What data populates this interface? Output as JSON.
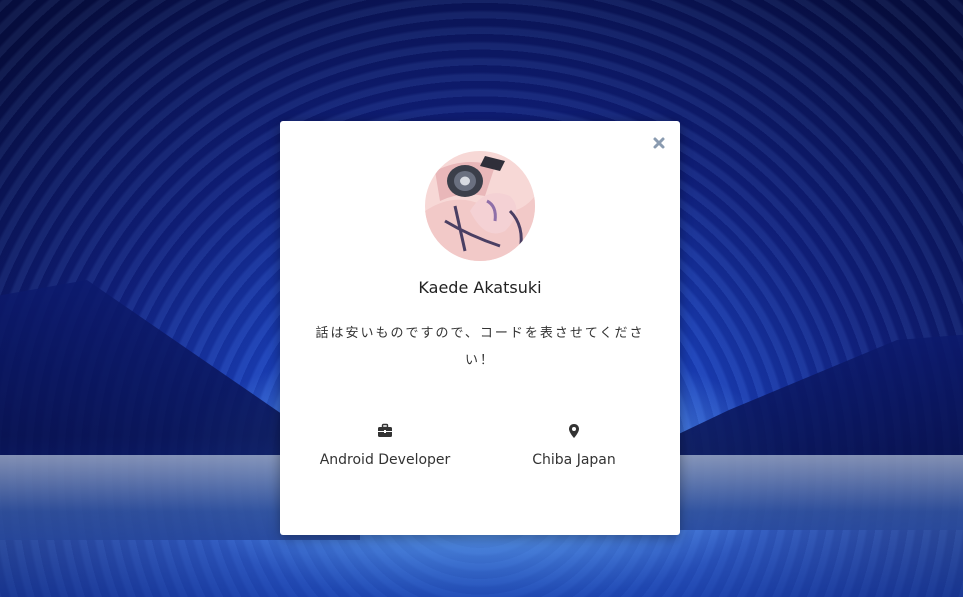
{
  "profile": {
    "name": "Kaede Akatsuki",
    "bio": "話は安いものですので、コードを表させてください！",
    "job": "Android Developer",
    "location": "Chiba Japan"
  },
  "icons": {
    "close": "close-icon",
    "job": "briefcase-icon",
    "location": "map-marker-icon"
  },
  "colors": {
    "modal_bg": "#ffffff",
    "text": "#333333",
    "close_icon": "#8a9bb0",
    "icon": "#333333"
  }
}
